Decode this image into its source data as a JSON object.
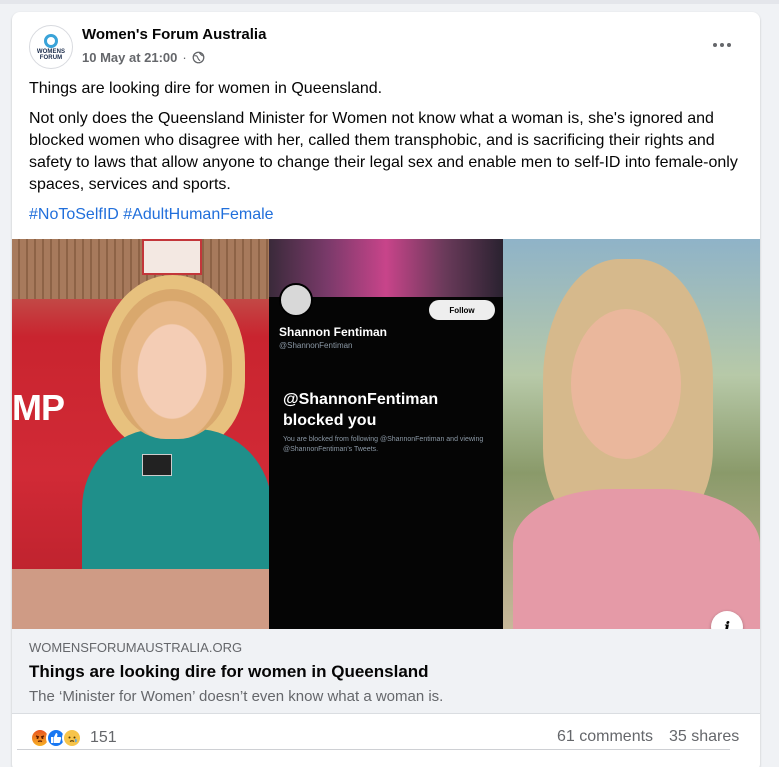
{
  "post": {
    "page_name": "Women's Forum Australia",
    "avatar_text": "WOMENS FORUM",
    "date": "10 May at 21:00",
    "separator": "·",
    "privacy_icon": "globe-icon",
    "more_icon": "more-horizontal-icon",
    "paragraph_1": "Things are looking dire for women in Queensland.",
    "paragraph_2": "Not only does the Queensland Minister for Women not know what a woman is, she's ignored and blocked women who disagree with her, called them transphobic, and is sacrificing their rights and safety to laws that allow anyone to change their legal sex and enable men to self-ID into female-only spaces, services and sports.",
    "hashtags": [
      "#NoToSelfID",
      "#AdultHumanFemale"
    ]
  },
  "image": {
    "left_panel_text": "MP",
    "twitter_name": "Shannon Fentiman",
    "twitter_handle": "@ShannonFentiman",
    "follow_label": "Follow",
    "blocked_title": "@ShannonFentiman blocked you",
    "blocked_sub": "You are blocked from following @ShannonFentiman and viewing @ShannonFentiman's Tweets.",
    "info_icon": "info-icon",
    "info_label": "i"
  },
  "link": {
    "domain": "WOMENSFORUMAUSTRALIA.ORG",
    "title": "Things are looking dire for women in Queensland",
    "description": "The ‘Minister for Women’ doesn’t even know what a woman is."
  },
  "stats": {
    "reactions": [
      "angry-reaction-icon",
      "like-reaction-icon",
      "sad-reaction-icon"
    ],
    "reaction_count": "151",
    "comments": "61 comments",
    "shares": "35 shares"
  },
  "colors": {
    "link_blue": "#216fdb",
    "like_blue": "#1877f2",
    "secondary_text": "#65676b"
  }
}
